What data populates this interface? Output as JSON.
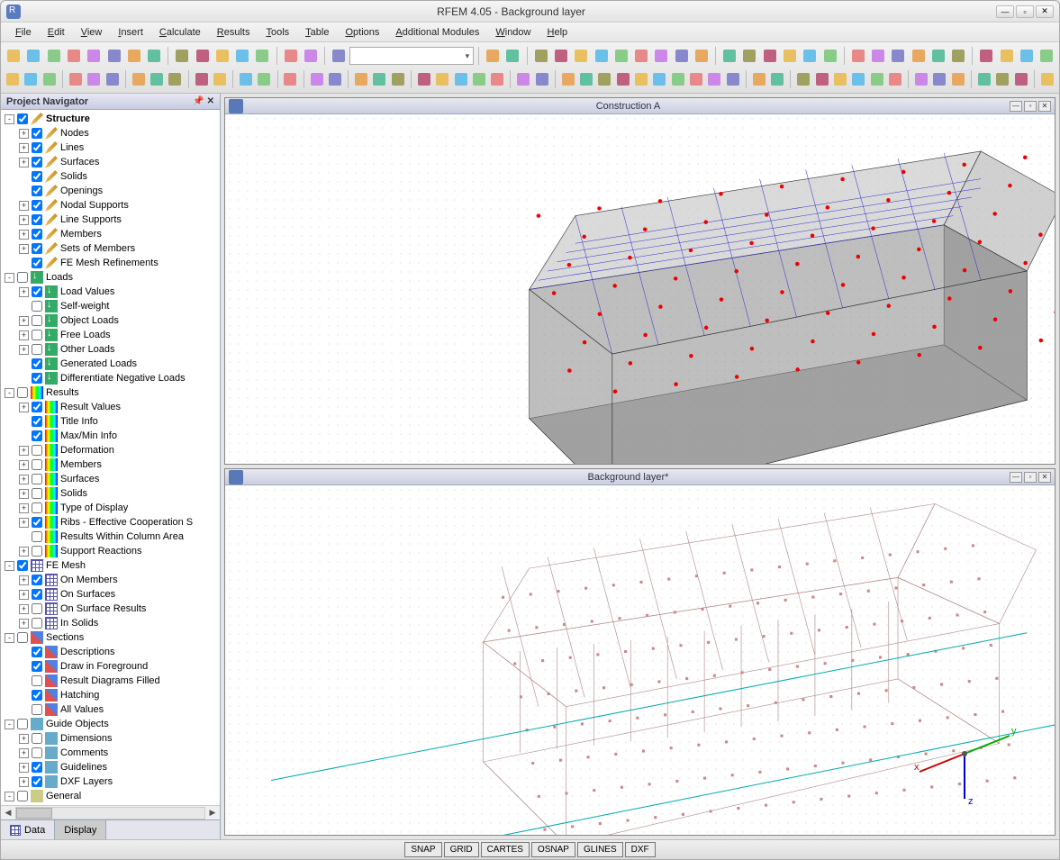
{
  "window": {
    "title": "RFEM 4.05 - Background layer"
  },
  "menu": [
    "File",
    "Edit",
    "View",
    "Insert",
    "Calculate",
    "Results",
    "Tools",
    "Table",
    "Options",
    "Additional Modules",
    "Window",
    "Help"
  ],
  "navigator": {
    "title": "Project Navigator",
    "tabs": [
      "Data",
      "Display"
    ],
    "tree": [
      {
        "d": 0,
        "exp": "-",
        "chk": true,
        "ico": "pencil",
        "lbl": "Structure",
        "bold": true
      },
      {
        "d": 1,
        "exp": "+",
        "chk": true,
        "ico": "pencil",
        "lbl": "Nodes"
      },
      {
        "d": 1,
        "exp": "+",
        "chk": true,
        "ico": "pencil",
        "lbl": "Lines"
      },
      {
        "d": 1,
        "exp": "+",
        "chk": true,
        "ico": "pencil",
        "lbl": "Surfaces"
      },
      {
        "d": 1,
        "exp": "",
        "chk": true,
        "ico": "pencil",
        "lbl": "Solids"
      },
      {
        "d": 1,
        "exp": "",
        "chk": true,
        "ico": "pencil",
        "lbl": "Openings"
      },
      {
        "d": 1,
        "exp": "+",
        "chk": true,
        "ico": "pencil",
        "lbl": "Nodal Supports"
      },
      {
        "d": 1,
        "exp": "+",
        "chk": true,
        "ico": "pencil",
        "lbl": "Line Supports"
      },
      {
        "d": 1,
        "exp": "+",
        "chk": true,
        "ico": "pencil",
        "lbl": "Members"
      },
      {
        "d": 1,
        "exp": "+",
        "chk": true,
        "ico": "pencil",
        "lbl": "Sets of Members"
      },
      {
        "d": 1,
        "exp": "",
        "chk": true,
        "ico": "pencil",
        "lbl": "FE Mesh Refinements"
      },
      {
        "d": 0,
        "exp": "-",
        "chk": false,
        "ico": "load",
        "lbl": "Loads"
      },
      {
        "d": 1,
        "exp": "+",
        "chk": true,
        "ico": "load",
        "lbl": "Load Values"
      },
      {
        "d": 1,
        "exp": "",
        "chk": false,
        "ico": "load",
        "lbl": "Self-weight"
      },
      {
        "d": 1,
        "exp": "+",
        "chk": false,
        "ico": "load",
        "lbl": "Object Loads"
      },
      {
        "d": 1,
        "exp": "+",
        "chk": false,
        "ico": "load",
        "lbl": "Free Loads"
      },
      {
        "d": 1,
        "exp": "+",
        "chk": false,
        "ico": "load",
        "lbl": "Other Loads"
      },
      {
        "d": 1,
        "exp": "",
        "chk": true,
        "ico": "load",
        "lbl": "Generated Loads"
      },
      {
        "d": 1,
        "exp": "",
        "chk": true,
        "ico": "load",
        "lbl": "Differentiate Negative Loads"
      },
      {
        "d": 0,
        "exp": "-",
        "chk": false,
        "ico": "res",
        "lbl": "Results"
      },
      {
        "d": 1,
        "exp": "+",
        "chk": true,
        "ico": "res",
        "lbl": "Result Values"
      },
      {
        "d": 1,
        "exp": "",
        "chk": true,
        "ico": "res",
        "lbl": "Title Info"
      },
      {
        "d": 1,
        "exp": "",
        "chk": true,
        "ico": "res",
        "lbl": "Max/Min Info"
      },
      {
        "d": 1,
        "exp": "+",
        "chk": false,
        "ico": "res",
        "lbl": "Deformation"
      },
      {
        "d": 1,
        "exp": "+",
        "chk": false,
        "ico": "res",
        "lbl": "Members"
      },
      {
        "d": 1,
        "exp": "+",
        "chk": false,
        "ico": "res",
        "lbl": "Surfaces"
      },
      {
        "d": 1,
        "exp": "+",
        "chk": false,
        "ico": "res",
        "lbl": "Solids"
      },
      {
        "d": 1,
        "exp": "+",
        "chk": false,
        "ico": "res",
        "lbl": "Type of Display"
      },
      {
        "d": 1,
        "exp": "+",
        "chk": true,
        "ico": "res",
        "lbl": "Ribs - Effective Cooperation S"
      },
      {
        "d": 1,
        "exp": "",
        "chk": false,
        "ico": "res",
        "lbl": "Results Within Column Area"
      },
      {
        "d": 1,
        "exp": "+",
        "chk": false,
        "ico": "res",
        "lbl": "Support Reactions"
      },
      {
        "d": 0,
        "exp": "-",
        "chk": true,
        "ico": "mesh",
        "lbl": "FE Mesh"
      },
      {
        "d": 1,
        "exp": "+",
        "chk": true,
        "ico": "mesh",
        "lbl": "On Members"
      },
      {
        "d": 1,
        "exp": "+",
        "chk": true,
        "ico": "mesh",
        "lbl": "On Surfaces"
      },
      {
        "d": 1,
        "exp": "+",
        "chk": false,
        "ico": "mesh",
        "lbl": "On Surface Results"
      },
      {
        "d": 1,
        "exp": "+",
        "chk": false,
        "ico": "mesh",
        "lbl": "In Solids"
      },
      {
        "d": 0,
        "exp": "-",
        "chk": false,
        "ico": "sect",
        "lbl": "Sections"
      },
      {
        "d": 1,
        "exp": "",
        "chk": true,
        "ico": "sect",
        "lbl": "Descriptions"
      },
      {
        "d": 1,
        "exp": "",
        "chk": true,
        "ico": "sect",
        "lbl": "Draw in Foreground"
      },
      {
        "d": 1,
        "exp": "",
        "chk": false,
        "ico": "sect",
        "lbl": "Result Diagrams Filled"
      },
      {
        "d": 1,
        "exp": "",
        "chk": true,
        "ico": "sect",
        "lbl": "Hatching"
      },
      {
        "d": 1,
        "exp": "",
        "chk": false,
        "ico": "sect",
        "lbl": "All Values"
      },
      {
        "d": 0,
        "exp": "-",
        "chk": false,
        "ico": "guide",
        "lbl": "Guide Objects"
      },
      {
        "d": 1,
        "exp": "+",
        "chk": false,
        "ico": "guide",
        "lbl": "Dimensions"
      },
      {
        "d": 1,
        "exp": "+",
        "chk": false,
        "ico": "guide",
        "lbl": "Comments"
      },
      {
        "d": 1,
        "exp": "+",
        "chk": true,
        "ico": "guide",
        "lbl": "Guidelines"
      },
      {
        "d": 1,
        "exp": "+",
        "chk": true,
        "ico": "guide",
        "lbl": "DXF Layers"
      },
      {
        "d": 0,
        "exp": "-",
        "chk": false,
        "ico": "gen",
        "lbl": "General"
      }
    ]
  },
  "views": {
    "top": {
      "title": "Construction A"
    },
    "bottom": {
      "title": "Background layer*"
    }
  },
  "status": [
    "SNAP",
    "GRID",
    "CARTES",
    "OSNAP",
    "GLINES",
    "DXF"
  ],
  "toolbar_icons_row1": [
    "new",
    "open",
    "save",
    "saveall",
    "print",
    "cut",
    "copy",
    "paste",
    "sep",
    "undo",
    "redo",
    "tool1",
    "tool2",
    "tool3",
    "sep",
    "sheet",
    "grid",
    "sep",
    "dot",
    "combo",
    "sep",
    "prev",
    "next",
    "sep",
    "arrow",
    "hand",
    "rotate",
    "eye",
    "frame",
    "cross",
    "screen",
    "window",
    "view3d",
    "sep",
    "calc1",
    "calc2",
    "calc3",
    "calc4",
    "calc5",
    "calc6",
    "sep",
    "measure",
    "origin",
    "axis",
    "cursor",
    "dim",
    "layer",
    "sep",
    "pdf",
    "excel",
    "mod",
    "help"
  ],
  "toolbar_icons_row2": [
    "sel",
    "selw",
    "node",
    "sep",
    "line",
    "arc",
    "spline",
    "sep",
    "beam1",
    "beam2",
    "beam3",
    "sep",
    "surf",
    "shell",
    "sep",
    "open",
    "hole",
    "sep",
    "cube",
    "sep",
    "mesh",
    "mesh2",
    "sep",
    "sup1",
    "sup2",
    "sup3",
    "sep",
    "load1",
    "load2",
    "load3",
    "load4",
    "load5",
    "sep",
    "gen1",
    "gen2",
    "sep",
    "view1",
    "view2",
    "view3",
    "view4",
    "view5",
    "view6",
    "view7",
    "view8",
    "view9",
    "viewa",
    "sep",
    "render1",
    "render2",
    "sep",
    "zoom1",
    "zoom2",
    "zoom3",
    "zoom4",
    "zoom5",
    "zoom6",
    "sep",
    "grp1",
    "grp2",
    "grp3",
    "sep",
    "res1",
    "res2",
    "res3",
    "sep",
    "graph"
  ]
}
